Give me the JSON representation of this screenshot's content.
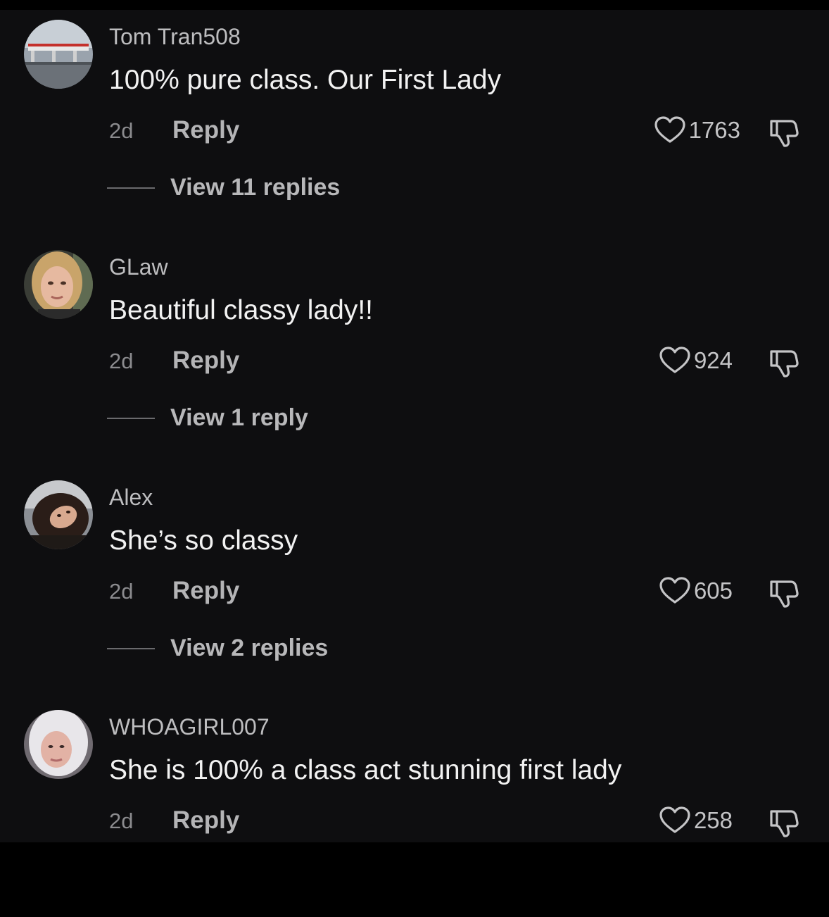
{
  "comments": [
    {
      "avatar_icon": "avatar-gas-station",
      "username": "Tom Tran508",
      "text": "100% pure class. Our First Lady",
      "time": "2d",
      "reply_label": "Reply",
      "likes": "1763",
      "view_replies": "View 11 replies"
    },
    {
      "avatar_icon": "avatar-blonde-woman",
      "username": "GLaw",
      "text": "Beautiful classy lady!!",
      "time": "2d",
      "reply_label": "Reply",
      "likes": "924",
      "view_replies": "View 1 reply"
    },
    {
      "avatar_icon": "avatar-dark-hair-woman",
      "username": "Alex",
      "text": "She’s so classy",
      "time": "2d",
      "reply_label": "Reply",
      "likes": "605",
      "view_replies": "View 2 replies"
    },
    {
      "avatar_icon": "avatar-platinum-hair-woman",
      "username": "WHOAGIRL007",
      "text": "She is 100% a class act stunning first lady",
      "time": "2d",
      "reply_label": "Reply",
      "likes": "258",
      "view_replies": ""
    }
  ]
}
